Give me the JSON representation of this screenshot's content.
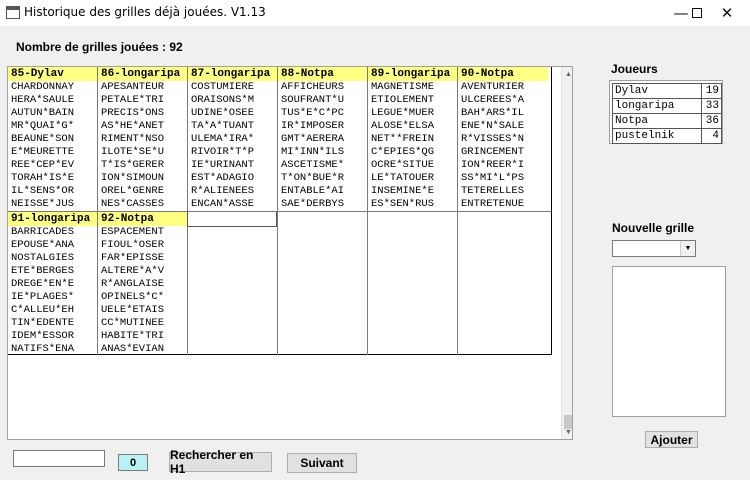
{
  "window": {
    "title": "Historique des grilles déjà jouées. V1.13"
  },
  "summary": {
    "label": "Nombre de grilles jouées : 92"
  },
  "history": {
    "top_columns": [
      {
        "header": "85-Dylav",
        "words": [
          "CHARDONNAY",
          "HERA*SAULE",
          "AUTUN*BAIN",
          "MR*QUAI*G*",
          "BEAUNE*SON",
          "E*MEURETTE",
          "REE*CEP*EV",
          "TORAH*IS*E",
          "IL*SENS*OR",
          "NEISSE*JUS"
        ]
      },
      {
        "header": "86-longaripa",
        "words": [
          "APESANTEUR",
          "PETALE*TRI",
          "PRECIS*ONS",
          "AS*HE*ANET",
          "RIMENT*NSO",
          "ILOTE*SE*U",
          "T*IS*GERER",
          "ION*SIMOUN",
          "OREL*GENRE",
          "NES*CASSES"
        ]
      },
      {
        "header": "87-longaripa",
        "words": [
          "COSTUMIERE",
          "ORAISONS*M",
          "UDINE*OSEE",
          "TA*A*TUANT",
          "ULEMA*IRA*",
          "RIVOIR*T*P",
          "IE*URINANT",
          "EST*ADAGIO",
          "R*ALIENEES",
          "ENCAN*ASSE"
        ]
      },
      {
        "header": "88-Notpa",
        "words": [
          "AFFICHEURS",
          "SOUFRANT*U",
          "TUS*E*C*PC",
          "IR*IMPOSER",
          "GMT*AERERA",
          "MI*INN*ILS",
          "ASCETISME*",
          "T*ON*BUE*R",
          "ENTABLE*AI",
          "SAE*DERBYS"
        ]
      },
      {
        "header": "89-longaripa",
        "words": [
          "MAGNETISME",
          "ETIOLEMENT",
          "LEGUE*MUER",
          "ALOSE*ELSA",
          "NET**FREIN",
          "C*EPIES*QG",
          "OCRE*SITUE",
          "LE*TATOUER",
          "INSEMINE*E",
          "ES*SEN*RUS"
        ]
      },
      {
        "header": "90-Notpa",
        "words": [
          "AVENTURIER",
          "ULCEREES*A",
          "BAH*ARS*IL",
          "ENE*N*SALE",
          "R*VISSES*N",
          "GRINCEMENT",
          "ION*REER*I",
          "SS*MI*L*PS",
          "TETERELLES",
          "ENTRETENUE"
        ]
      }
    ],
    "bottom_columns": [
      {
        "header": "91-longaripa",
        "words": [
          "BARRICADES",
          "EPOUSE*ANA",
          "NOSTALGIES",
          "ETE*BERGES",
          "DREGE*EN*E",
          "IE*PLAGES*",
          "C*ALLEU*EH",
          "TIN*EDENTE",
          "IDEM*ESSOR",
          "NATIFS*ENA"
        ]
      },
      {
        "header": "92-Notpa",
        "words": [
          "ESPACEMENT",
          "FIOUL*OSER",
          "FAR*EPISSE",
          "ALTERE*A*V",
          "R*ANGLAISE",
          "OPINELS*C*",
          "UELE*ETAIS",
          "CC*MUTINEE",
          "HABITE*TRI",
          "ANAS*EVIAN"
        ]
      }
    ]
  },
  "players": {
    "label": "Joueurs",
    "rows": [
      {
        "name": "Dylav",
        "count": "19"
      },
      {
        "name": "longaripa",
        "count": "33"
      },
      {
        "name": "Notpa",
        "count": "36"
      },
      {
        "name": "pustelnik",
        "count": "4"
      }
    ]
  },
  "new_grid": {
    "label": "Nouvelle grille",
    "selected": ""
  },
  "buttons": {
    "add": "Ajouter",
    "search": "Rechercher en H1",
    "next": "Suivant"
  },
  "search": {
    "value": "",
    "result_count": "0"
  }
}
